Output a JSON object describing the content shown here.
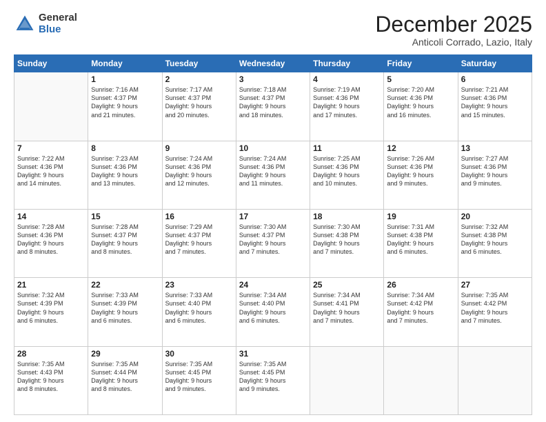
{
  "logo": {
    "general": "General",
    "blue": "Blue"
  },
  "header": {
    "month": "December 2025",
    "location": "Anticoli Corrado, Lazio, Italy"
  },
  "days_of_week": [
    "Sunday",
    "Monday",
    "Tuesday",
    "Wednesday",
    "Thursday",
    "Friday",
    "Saturday"
  ],
  "weeks": [
    [
      {
        "day": "",
        "info": ""
      },
      {
        "day": "1",
        "info": "Sunrise: 7:16 AM\nSunset: 4:37 PM\nDaylight: 9 hours\nand 21 minutes."
      },
      {
        "day": "2",
        "info": "Sunrise: 7:17 AM\nSunset: 4:37 PM\nDaylight: 9 hours\nand 20 minutes."
      },
      {
        "day": "3",
        "info": "Sunrise: 7:18 AM\nSunset: 4:37 PM\nDaylight: 9 hours\nand 18 minutes."
      },
      {
        "day": "4",
        "info": "Sunrise: 7:19 AM\nSunset: 4:36 PM\nDaylight: 9 hours\nand 17 minutes."
      },
      {
        "day": "5",
        "info": "Sunrise: 7:20 AM\nSunset: 4:36 PM\nDaylight: 9 hours\nand 16 minutes."
      },
      {
        "day": "6",
        "info": "Sunrise: 7:21 AM\nSunset: 4:36 PM\nDaylight: 9 hours\nand 15 minutes."
      }
    ],
    [
      {
        "day": "7",
        "info": "Sunrise: 7:22 AM\nSunset: 4:36 PM\nDaylight: 9 hours\nand 14 minutes."
      },
      {
        "day": "8",
        "info": "Sunrise: 7:23 AM\nSunset: 4:36 PM\nDaylight: 9 hours\nand 13 minutes."
      },
      {
        "day": "9",
        "info": "Sunrise: 7:24 AM\nSunset: 4:36 PM\nDaylight: 9 hours\nand 12 minutes."
      },
      {
        "day": "10",
        "info": "Sunrise: 7:24 AM\nSunset: 4:36 PM\nDaylight: 9 hours\nand 11 minutes."
      },
      {
        "day": "11",
        "info": "Sunrise: 7:25 AM\nSunset: 4:36 PM\nDaylight: 9 hours\nand 10 minutes."
      },
      {
        "day": "12",
        "info": "Sunrise: 7:26 AM\nSunset: 4:36 PM\nDaylight: 9 hours\nand 9 minutes."
      },
      {
        "day": "13",
        "info": "Sunrise: 7:27 AM\nSunset: 4:36 PM\nDaylight: 9 hours\nand 9 minutes."
      }
    ],
    [
      {
        "day": "14",
        "info": "Sunrise: 7:28 AM\nSunset: 4:36 PM\nDaylight: 9 hours\nand 8 minutes."
      },
      {
        "day": "15",
        "info": "Sunrise: 7:28 AM\nSunset: 4:37 PM\nDaylight: 9 hours\nand 8 minutes."
      },
      {
        "day": "16",
        "info": "Sunrise: 7:29 AM\nSunset: 4:37 PM\nDaylight: 9 hours\nand 7 minutes."
      },
      {
        "day": "17",
        "info": "Sunrise: 7:30 AM\nSunset: 4:37 PM\nDaylight: 9 hours\nand 7 minutes."
      },
      {
        "day": "18",
        "info": "Sunrise: 7:30 AM\nSunset: 4:38 PM\nDaylight: 9 hours\nand 7 minutes."
      },
      {
        "day": "19",
        "info": "Sunrise: 7:31 AM\nSunset: 4:38 PM\nDaylight: 9 hours\nand 6 minutes."
      },
      {
        "day": "20",
        "info": "Sunrise: 7:32 AM\nSunset: 4:38 PM\nDaylight: 9 hours\nand 6 minutes."
      }
    ],
    [
      {
        "day": "21",
        "info": "Sunrise: 7:32 AM\nSunset: 4:39 PM\nDaylight: 9 hours\nand 6 minutes."
      },
      {
        "day": "22",
        "info": "Sunrise: 7:33 AM\nSunset: 4:39 PM\nDaylight: 9 hours\nand 6 minutes."
      },
      {
        "day": "23",
        "info": "Sunrise: 7:33 AM\nSunset: 4:40 PM\nDaylight: 9 hours\nand 6 minutes."
      },
      {
        "day": "24",
        "info": "Sunrise: 7:34 AM\nSunset: 4:40 PM\nDaylight: 9 hours\nand 6 minutes."
      },
      {
        "day": "25",
        "info": "Sunrise: 7:34 AM\nSunset: 4:41 PM\nDaylight: 9 hours\nand 7 minutes."
      },
      {
        "day": "26",
        "info": "Sunrise: 7:34 AM\nSunset: 4:42 PM\nDaylight: 9 hours\nand 7 minutes."
      },
      {
        "day": "27",
        "info": "Sunrise: 7:35 AM\nSunset: 4:42 PM\nDaylight: 9 hours\nand 7 minutes."
      }
    ],
    [
      {
        "day": "28",
        "info": "Sunrise: 7:35 AM\nSunset: 4:43 PM\nDaylight: 9 hours\nand 8 minutes."
      },
      {
        "day": "29",
        "info": "Sunrise: 7:35 AM\nSunset: 4:44 PM\nDaylight: 9 hours\nand 8 minutes."
      },
      {
        "day": "30",
        "info": "Sunrise: 7:35 AM\nSunset: 4:45 PM\nDaylight: 9 hours\nand 9 minutes."
      },
      {
        "day": "31",
        "info": "Sunrise: 7:35 AM\nSunset: 4:45 PM\nDaylight: 9 hours\nand 9 minutes."
      },
      {
        "day": "",
        "info": ""
      },
      {
        "day": "",
        "info": ""
      },
      {
        "day": "",
        "info": ""
      }
    ]
  ]
}
